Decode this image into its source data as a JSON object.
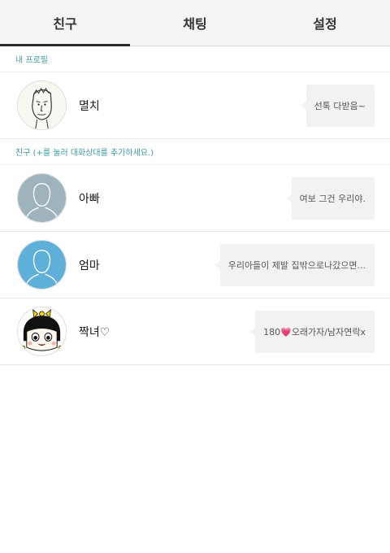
{
  "tabs": [
    {
      "label": "친구",
      "active": true
    },
    {
      "label": "채팅",
      "active": false
    },
    {
      "label": "설정",
      "active": false
    }
  ],
  "my_profile": {
    "header": "내 프로필",
    "name": "멸치",
    "status": "선톡 다받음~",
    "avatar": "sketch-face-avatar"
  },
  "friends_header": "친구 (+를 눌러 대화상대를 추가하세요.)",
  "friends": [
    {
      "name": "아빠",
      "status": "여보 그건 우리야.",
      "avatar": "default-gray-avatar",
      "avatar_color": "#9fb3bd"
    },
    {
      "name": "엄마",
      "status": "우리아들이 제발 집밖으로나갔으면...",
      "avatar": "default-blue-avatar",
      "avatar_color": "#5fb0d9"
    },
    {
      "name": "짝녀♡",
      "status": "180💗오래가자/남자연락x",
      "avatar": "cartoon-girl-avatar"
    }
  ],
  "colors": {
    "accent": "#3f9ca3",
    "tab_bg": "#f4f4f5",
    "bubble_bg": "#f2f2f2"
  }
}
